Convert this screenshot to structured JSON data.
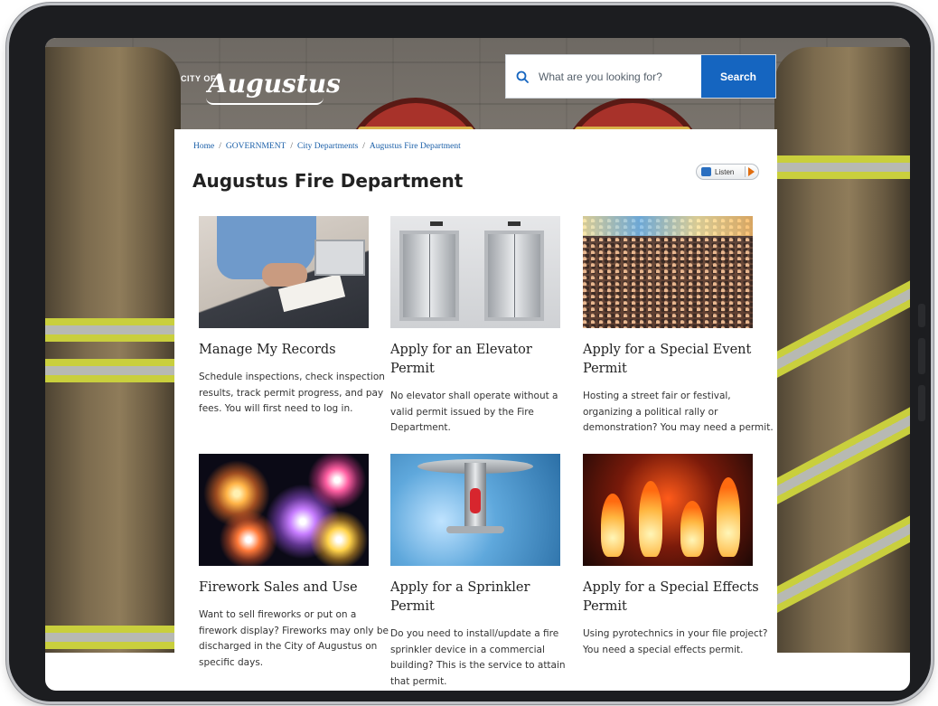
{
  "header": {
    "logo_small": "CITY OF",
    "logo_script": "Augustus",
    "search_placeholder": "What are you looking for?",
    "search_button": "Search"
  },
  "breadcrumb": [
    {
      "label": "Home"
    },
    {
      "label": "GOVERNMENT"
    },
    {
      "label": "City Departments"
    },
    {
      "label": "Augustus Fire Department"
    }
  ],
  "breadcrumb_separator": "/",
  "page_title": "Augustus Fire Department",
  "listen_label": "Listen",
  "cards": [
    {
      "title_lines": [
        "Manage My Records"
      ],
      "desc_lines": [
        "Schedule inspections, check inspection",
        "results, track permit progress, and pay",
        "fees. You will first need to log in."
      ]
    },
    {
      "title_lines": [
        "Apply for an Elevator",
        "Permit"
      ],
      "desc_lines": [
        "No elevator shall operate without a",
        "valid permit issued by the Fire",
        "Department."
      ]
    },
    {
      "title_lines": [
        "Apply for a Special Event",
        "Permit"
      ],
      "desc_lines": [
        "Hosting a street fair or festival,",
        "organizing a political rally or",
        "demonstration? You may need a permit."
      ]
    },
    {
      "title_lines": [
        "Firework Sales and Use"
      ],
      "desc_lines": [
        "Want to sell fireworks or put on a",
        "firework display? Fireworks may only be",
        "discharged in the City of Augustus on",
        "specific days."
      ]
    },
    {
      "title_lines": [
        "Apply for a Sprinkler",
        "Permit"
      ],
      "desc_lines": [
        "Do you need to install/update a fire",
        "sprinkler device in a commercial",
        "building? This is the service to attain",
        "that permit."
      ]
    },
    {
      "title_lines": [
        "Apply for a Special Effects",
        "Permit"
      ],
      "desc_lines": [
        "Using pyrotechnics in your file project?",
        "You need a special effects permit."
      ]
    }
  ],
  "colors": {
    "search_button": "#1565c0",
    "link": "#1a5fa8",
    "title_text": "#222222"
  },
  "icons": [
    "search-icon",
    "speaker-icon",
    "play-icon"
  ]
}
